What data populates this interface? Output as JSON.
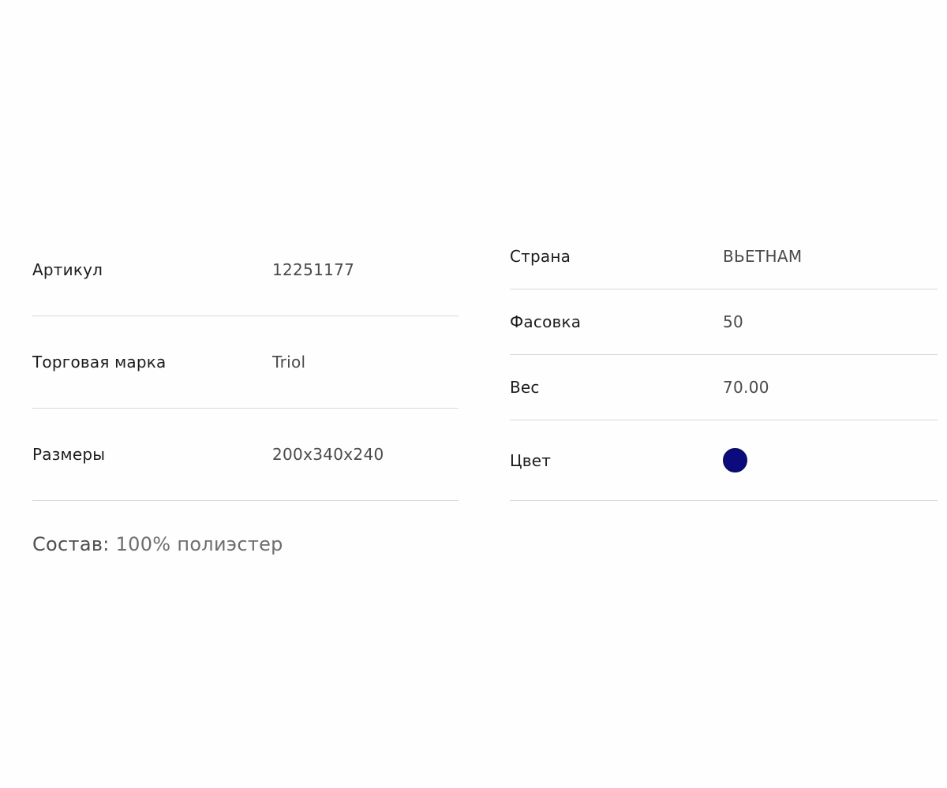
{
  "specs_left": [
    {
      "label": "Артикул",
      "value": "12251177"
    },
    {
      "label": "Торговая марка",
      "value": "Triol"
    },
    {
      "label": "Размеры",
      "value": "200x340x240"
    }
  ],
  "specs_right": [
    {
      "label": "Страна",
      "value": "ВЬЕТНАМ"
    },
    {
      "label": "Фасовка",
      "value": "50"
    },
    {
      "label": "Вес",
      "value": "70.00"
    },
    {
      "label": "Цвет",
      "color": "#0b0b7e"
    }
  ],
  "composition": {
    "label": "Состав:",
    "value": "100% полиэстер"
  }
}
